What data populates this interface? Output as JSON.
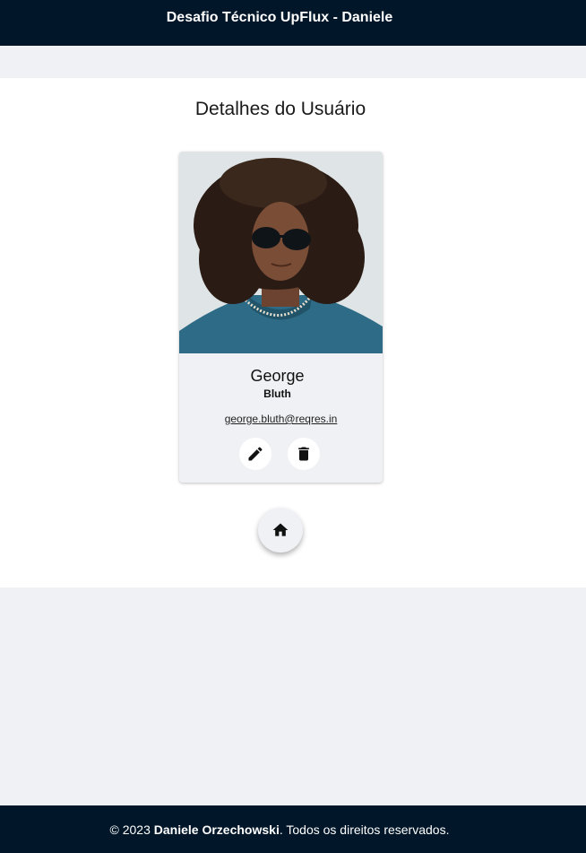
{
  "header": {
    "title": "Desafio Técnico UpFlux - Daniele"
  },
  "page": {
    "title": "Detalhes do Usuário"
  },
  "user": {
    "first_name": "George",
    "last_name": "Bluth",
    "email": "george.bluth@reqres.in"
  },
  "actions": {
    "edit_icon": "pencil-icon",
    "delete_icon": "trash-icon",
    "home_icon": "home-icon"
  },
  "footer": {
    "prefix": "© 2023",
    "author": "Daniele Orzechowski",
    "suffix": ". Todos os direitos reservados."
  },
  "colors": {
    "header_bg": "#011628",
    "page_bg": "#eff1f5",
    "panel_bg": "#ffffff"
  }
}
